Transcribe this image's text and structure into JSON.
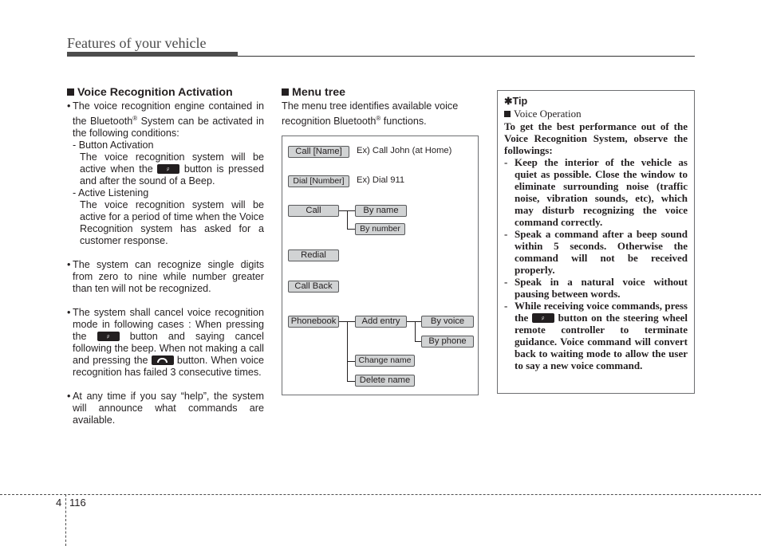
{
  "header": {
    "title": "Features of your vehicle"
  },
  "voice_activation": {
    "heading": "Voice Recognition Activation",
    "bullet1": {
      "text_a": "The voice recognition engine contained in the Bluetooth",
      "reg": "®",
      "text_b": " System can be activated in the following conditions:",
      "sub1_label": "- Button Activation",
      "sub1_body_a": "The voice recognition system will be active when the ",
      "sub1_body_b": " button is pressed and after the sound of a Beep.",
      "sub2_label": "- Active Listening",
      "sub2_body": "The voice recognition system will be active for a period of time when the Voice Recognition system has asked for a customer response."
    },
    "bullet2": "The system can recognize single digits from zero to nine while number greater than ten will not be recognized.",
    "bullet3": {
      "a": "The system shall cancel voice recognition mode in following cases : When pressing the ",
      "b": " button and saying cancel following the beep. When not making a call and pressing the ",
      "c": " button. When voice recognition has failed 3 consecutive times."
    },
    "bullet4": "At any time if you say “help”, the system will announce what commands are available.",
    "icons": {
      "voice_button": "voice-talk-button-icon",
      "hangup_button": "hang-up-button-icon"
    }
  },
  "menu_tree": {
    "heading": "Menu tree",
    "intro_a": "The menu tree identifies available voice recognition Bluetooth",
    "intro_reg": "®",
    "intro_b": " functions.",
    "nodes": {
      "call_name": "Call [Name]",
      "call_name_ex": "Ex) Call John (at Home)",
      "dial_number": "Dial [Number]",
      "dial_number_ex": "Ex) Dial 911",
      "call": "Call",
      "by_name": "By name",
      "by_number": "By number",
      "redial": "Redial",
      "call_back": "Call Back",
      "phonebook": "Phonebook",
      "add_entry": "Add entry",
      "by_voice": "By voice",
      "by_phone": "By phone",
      "change_name": "Change name",
      "delete_name": "Delete name"
    }
  },
  "tip": {
    "label": "✱Tip",
    "subheading": "Voice Operation",
    "intro": "To get the best performance out of the Voice Recognition System, observe the followings:",
    "items": [
      "Keep the interior of the vehicle as quiet as possible. Close the window to eliminate surrounding noise (traffic noise, vibration sounds, etc), which may disturb recognizing the voice command correctly.",
      "Speak a command after a beep sound within 5 seconds. Otherwise the command will not be received properly.",
      "Speak in a natural voice without pausing between words."
    ],
    "item4_a": "While receiving voice commands, press the ",
    "item4_b": " button on the steering wheel remote controller to terminate guidance. Voice command will convert back to waiting mode to allow the user to say a new voice command."
  },
  "footer": {
    "chapter": "4",
    "page": "116"
  }
}
